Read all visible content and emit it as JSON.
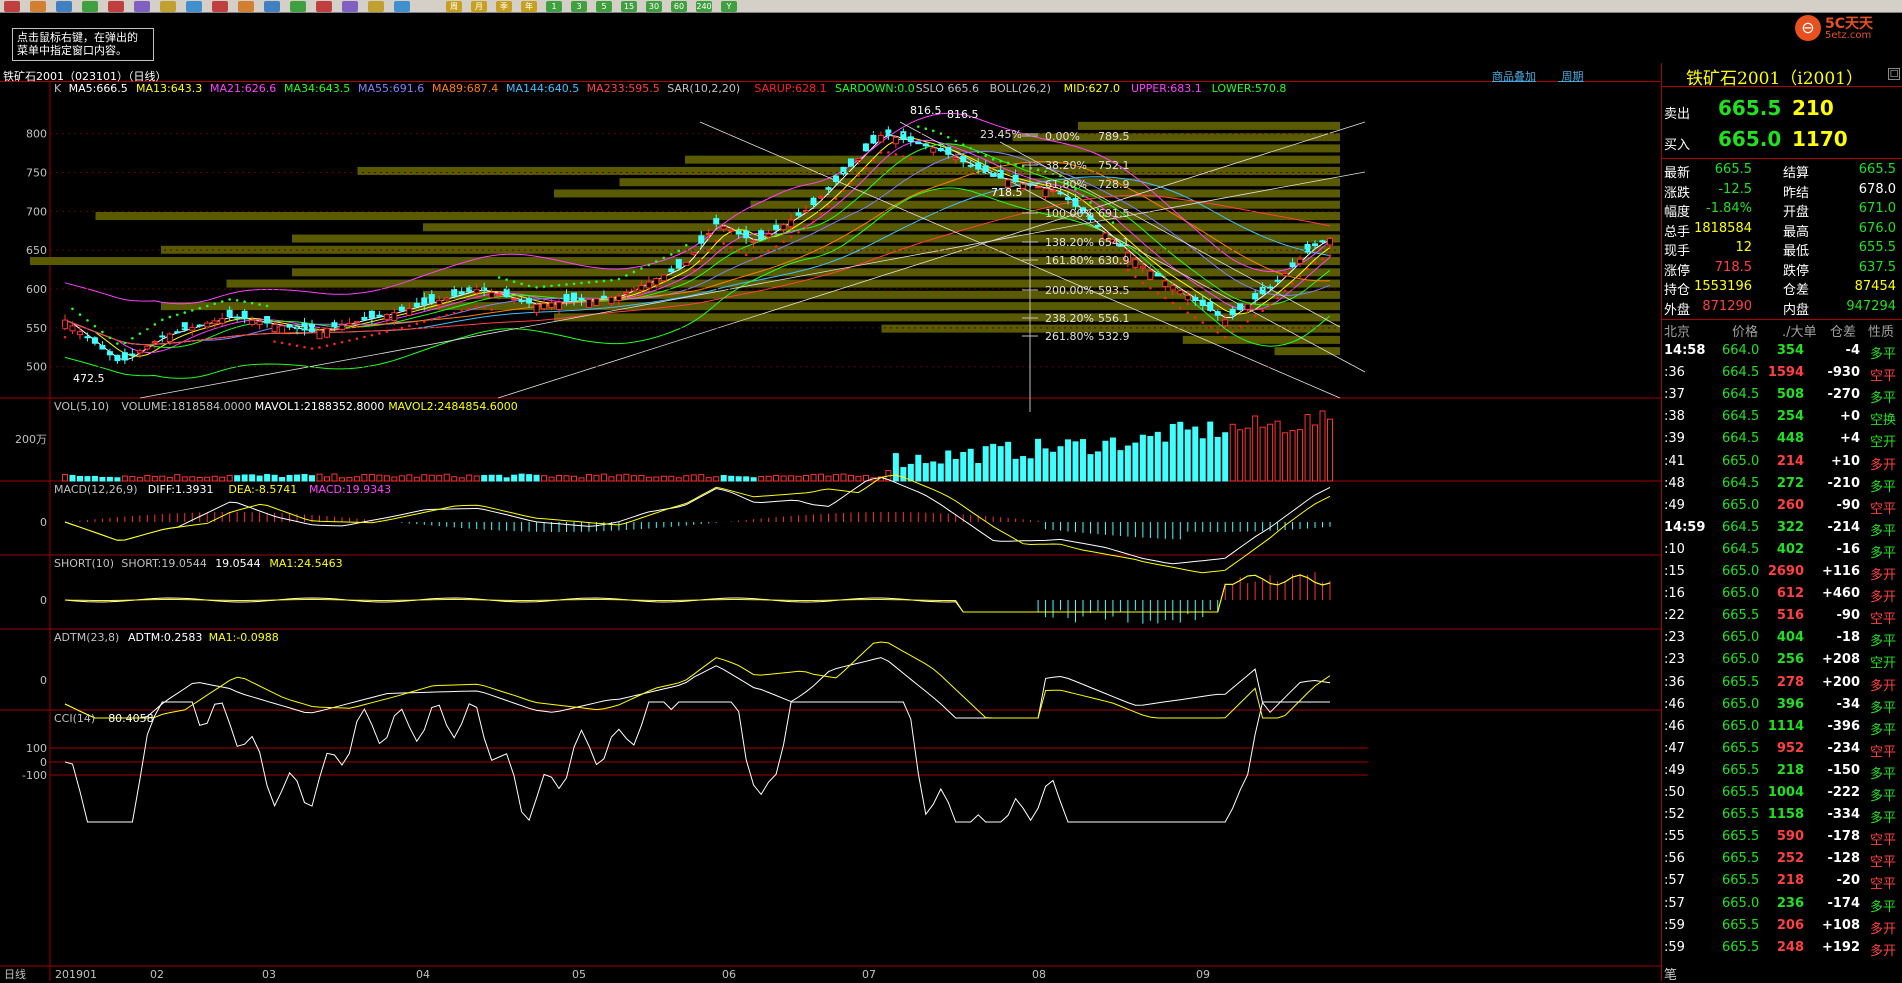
{
  "toolbar": {
    "buttons": [
      "周",
      "月",
      "季",
      "年",
      "1",
      "3",
      "5",
      "15",
      "30",
      "60",
      "240",
      "Y"
    ]
  },
  "tip": {
    "line1": "点击鼠标右键，在弹出的",
    "line2": "菜单中指定窗口内容。"
  },
  "logo": {
    "name": "5C天天",
    "url": "5etz.com"
  },
  "chart_header": {
    "title": "铁矿石2001（023101）（日线）",
    "link_overlay": "商品叠加",
    "link_period": "周期"
  },
  "colors": {
    "up": "#ff3030",
    "down": "#40ffff",
    "bg": "#000000",
    "grid": "#a00000"
  },
  "main_panel": {
    "legend": [
      {
        "text": "K",
        "color": "#c0c0c0"
      },
      {
        "text": "MA5:666.5",
        "color": "#ffffff"
      },
      {
        "text": "MA13:643.3",
        "color": "#ffff00"
      },
      {
        "text": "MA21:626.6",
        "color": "#ff40ff"
      },
      {
        "text": "MA34:643.5",
        "color": "#20ff20"
      },
      {
        "text": "MA55:691.6",
        "color": "#8080ff"
      },
      {
        "text": "MA89:687.4",
        "color": "#ff8000"
      },
      {
        "text": "MA144:640.5",
        "color": "#40c0ff"
      },
      {
        "text": "MA233:595.5",
        "color": "#ff4040"
      },
      {
        "text": "SAR(10,2,20)",
        "color": "#c0c0c0"
      },
      {
        "text": "SARUP:628.1",
        "color": "#ff2020"
      },
      {
        "text": "SARDOWN:0.0",
        "color": "#20ff20"
      },
      {
        "text": "SSLO 665.6",
        "color": "#c0c0c0"
      },
      {
        "text": "BOLL(26,2)",
        "color": "#c0c0c0"
      },
      {
        "text": "MID:627.0",
        "color": "#ffff00"
      },
      {
        "text": "UPPER:683.1",
        "color": "#ff40ff"
      },
      {
        "text": "LOWER:570.8",
        "color": "#20ff20"
      }
    ],
    "yaxis": [
      "800",
      "750",
      "700",
      "650",
      "600",
      "550",
      "500"
    ],
    "annotations": [
      "816.5",
      "816.5",
      "718.5",
      "472.5"
    ],
    "fib_levels": [
      {
        "pct": "23.45%",
        "val": ""
      },
      {
        "pct": "0.00%",
        "val": "789.5"
      },
      {
        "pct": "38.20%",
        "val": "752.1"
      },
      {
        "pct": "61.80%",
        "val": "728.9"
      },
      {
        "pct": "100.00%",
        "val": "691.5"
      },
      {
        "pct": "138.20%",
        "val": "654.1"
      },
      {
        "pct": "161.80%",
        "val": "630.9"
      },
      {
        "pct": "200.00%",
        "val": "593.5"
      },
      {
        "pct": "238.20%",
        "val": "556.1"
      },
      {
        "pct": "261.80%",
        "val": "532.9"
      }
    ]
  },
  "vol_panel": {
    "legend": [
      {
        "text": "VOL(5,10)",
        "color": "#c0c0c0"
      },
      {
        "text": "VOLUME:1818584.0000",
        "color": "#c0c0c0"
      },
      {
        "text": "MAVOL1:2188352.8000",
        "color": "#ffffff"
      },
      {
        "text": "MAVOL2:2484854.6000",
        "color": "#ffff00"
      }
    ],
    "yaxis": [
      "200万"
    ]
  },
  "macd_panel": {
    "legend": [
      {
        "text": "MACD(12,26,9)",
        "color": "#c0c0c0"
      },
      {
        "text": "DIFF:1.3931",
        "color": "#ffffff"
      },
      {
        "text": "DEA:-8.5741",
        "color": "#ffff00"
      },
      {
        "text": "MACD:19.9343",
        "color": "#ff40ff"
      }
    ],
    "yaxis": [
      "0"
    ]
  },
  "short_panel": {
    "legend": [
      {
        "text": "SHORT(10)",
        "color": "#c0c0c0"
      },
      {
        "text": "SHORT:19.0544",
        "color": "#c0c0c0"
      },
      {
        "text": "19.0544",
        "color": "#ffffff"
      },
      {
        "text": "MA1:24.5463",
        "color": "#ffff00"
      }
    ],
    "yaxis": [
      "0"
    ]
  },
  "adtm_panel": {
    "legend": [
      {
        "text": "ADTM(23,8)",
        "color": "#c0c0c0"
      },
      {
        "text": "ADTM:0.2583",
        "color": "#ffffff"
      },
      {
        "text": "MA1:-0.0988",
        "color": "#ffff00"
      }
    ],
    "yaxis": [
      "0"
    ]
  },
  "cci_panel": {
    "legend": [
      {
        "text": "CCI(14)",
        "color": "#c0c0c0"
      },
      {
        "text": "80.4058",
        "color": "#ffffff"
      }
    ],
    "yaxis": [
      "100",
      "0",
      "-100"
    ]
  },
  "xaxis": {
    "period_label": "日线",
    "labels": [
      "201901",
      "02",
      "03",
      "04",
      "05",
      "06",
      "07",
      "08",
      "09"
    ]
  },
  "quote": {
    "title": "铁矿石2001（i2001）",
    "sell_label": "卖出",
    "sell_price": "665.5",
    "sell_vol": "210",
    "buy_label": "买入",
    "buy_price": "665.0",
    "buy_vol": "1170",
    "rows": [
      {
        "l1": "最新",
        "v1": "665.5",
        "c1": "green",
        "l2": "结算",
        "v2": "665.5",
        "c2": "green"
      },
      {
        "l1": "涨跌",
        "v1": "-12.5",
        "c1": "green",
        "l2": "昨结",
        "v2": "678.0",
        "c2": "white"
      },
      {
        "l1": "幅度",
        "v1": "-1.84%",
        "c1": "green",
        "l2": "开盘",
        "v2": "671.0",
        "c2": "green"
      },
      {
        "l1": "总手",
        "v1": "1818584",
        "c1": "yellow",
        "l2": "最高",
        "v2": "676.0",
        "c2": "green"
      },
      {
        "l1": "现手",
        "v1": "12",
        "c1": "yellow",
        "l2": "最低",
        "v2": "655.5",
        "c2": "green"
      },
      {
        "l1": "涨停",
        "v1": "718.5",
        "c1": "red",
        "l2": "跌停",
        "v2": "637.5",
        "c2": "green"
      },
      {
        "l1": "持仓",
        "v1": "1553196",
        "c1": "yellow",
        "l2": "仓差",
        "v2": "87454",
        "c2": "yellow"
      },
      {
        "l1": "外盘",
        "v1": "871290",
        "c1": "red",
        "l2": "内盘",
        "v2": "947294",
        "c2": "green"
      }
    ],
    "tick_header": {
      "loc": "北京",
      "price": "价格",
      "vol": "./大单",
      "oi": "仓差",
      "nature": "性质"
    },
    "ticks": [
      {
        "t": "14:58",
        "p": "664.0",
        "v": "354",
        "vc": "green",
        "o": "-4",
        "n": "多平",
        "nc": "green",
        "bold": true
      },
      {
        "t": ":36",
        "p": "664.5",
        "v": "1594",
        "vc": "red",
        "o": "-930",
        "n": "空平",
        "nc": "red"
      },
      {
        "t": ":37",
        "p": "664.5",
        "v": "508",
        "vc": "green",
        "o": "-270",
        "n": "多平",
        "nc": "green"
      },
      {
        "t": ":38",
        "p": "664.5",
        "v": "254",
        "vc": "green",
        "o": "+0",
        "n": "空换",
        "nc": "green"
      },
      {
        "t": ":39",
        "p": "664.5",
        "v": "448",
        "vc": "green",
        "o": "+4",
        "n": "空开",
        "nc": "green"
      },
      {
        "t": ":41",
        "p": "665.0",
        "v": "214",
        "vc": "red",
        "o": "+10",
        "n": "多开",
        "nc": "red"
      },
      {
        "t": ":48",
        "p": "664.5",
        "v": "272",
        "vc": "green",
        "o": "-210",
        "n": "多平",
        "nc": "green"
      },
      {
        "t": ":49",
        "p": "665.0",
        "v": "260",
        "vc": "red",
        "o": "-90",
        "n": "空平",
        "nc": "red"
      },
      {
        "t": "14:59",
        "p": "664.5",
        "v": "322",
        "vc": "green",
        "o": "-214",
        "n": "多平",
        "nc": "green",
        "bold": true
      },
      {
        "t": ":10",
        "p": "664.5",
        "v": "402",
        "vc": "green",
        "o": "-16",
        "n": "多平",
        "nc": "green"
      },
      {
        "t": ":15",
        "p": "665.0",
        "v": "2690",
        "vc": "red",
        "o": "+116",
        "n": "多开",
        "nc": "red"
      },
      {
        "t": ":16",
        "p": "665.0",
        "v": "612",
        "vc": "red",
        "o": "+460",
        "n": "多开",
        "nc": "red"
      },
      {
        "t": ":22",
        "p": "665.5",
        "v": "516",
        "vc": "red",
        "o": "-90",
        "n": "空平",
        "nc": "red"
      },
      {
        "t": ":23",
        "p": "665.0",
        "v": "404",
        "vc": "green",
        "o": "-18",
        "n": "多平",
        "nc": "green"
      },
      {
        "t": ":23",
        "p": "665.0",
        "v": "256",
        "vc": "green",
        "o": "+208",
        "n": "空开",
        "nc": "green"
      },
      {
        "t": ":36",
        "p": "665.5",
        "v": "278",
        "vc": "red",
        "o": "+200",
        "n": "多开",
        "nc": "red"
      },
      {
        "t": ":46",
        "p": "665.0",
        "v": "396",
        "vc": "green",
        "o": "-34",
        "n": "多平",
        "nc": "green"
      },
      {
        "t": ":46",
        "p": "665.0",
        "v": "1114",
        "vc": "green",
        "o": "-396",
        "n": "多平",
        "nc": "green"
      },
      {
        "t": ":47",
        "p": "665.5",
        "v": "952",
        "vc": "red",
        "o": "-234",
        "n": "空平",
        "nc": "red"
      },
      {
        "t": ":49",
        "p": "665.5",
        "v": "218",
        "vc": "green",
        "o": "-150",
        "n": "多平",
        "nc": "green"
      },
      {
        "t": ":50",
        "p": "665.5",
        "v": "1004",
        "vc": "green",
        "o": "-222",
        "n": "多平",
        "nc": "green"
      },
      {
        "t": ":52",
        "p": "665.5",
        "v": "1158",
        "vc": "green",
        "o": "-334",
        "n": "多平",
        "nc": "green"
      },
      {
        "t": ":55",
        "p": "665.5",
        "v": "590",
        "vc": "red",
        "o": "-178",
        "n": "空平",
        "nc": "red"
      },
      {
        "t": ":56",
        "p": "665.5",
        "v": "252",
        "vc": "red",
        "o": "-128",
        "n": "空平",
        "nc": "red"
      },
      {
        "t": ":57",
        "p": "665.5",
        "v": "218",
        "vc": "red",
        "o": "-20",
        "n": "空平",
        "nc": "red"
      },
      {
        "t": ":57",
        "p": "665.0",
        "v": "236",
        "vc": "green",
        "o": "-174",
        "n": "多平",
        "nc": "green"
      },
      {
        "t": ":59",
        "p": "665.5",
        "v": "206",
        "vc": "red",
        "o": "+108",
        "n": "多开",
        "nc": "red"
      },
      {
        "t": ":59",
        "p": "665.5",
        "v": "248",
        "vc": "red",
        "o": "+192",
        "n": "多开",
        "nc": "red"
      }
    ],
    "footer": "笔"
  }
}
